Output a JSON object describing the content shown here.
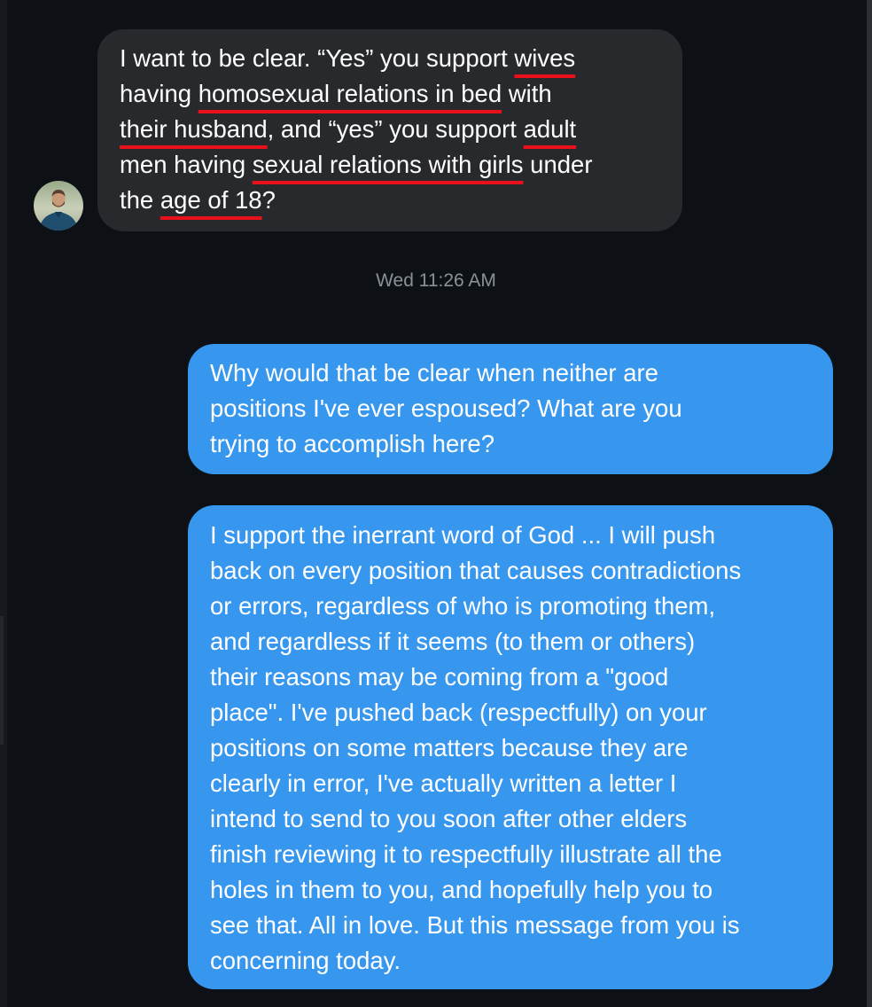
{
  "conversation": {
    "incoming_message": {
      "lines": [
        [
          {
            "text": "I want to be clear. “Yes” you support ",
            "underlined": false
          },
          {
            "text": "wives",
            "underlined": true
          }
        ],
        [
          {
            "text": "having ",
            "underlined": false
          },
          {
            "text": "homosexual relations in bed",
            "underlined": true
          },
          {
            "text": " with",
            "underlined": false
          }
        ],
        [
          {
            "text": "their husband",
            "underlined": true
          },
          {
            "text": ", and “yes” you support ",
            "underlined": false
          },
          {
            "text": "adult",
            "underlined": true
          }
        ],
        [
          {
            "text": "men having ",
            "underlined": false
          },
          {
            "text": "sexual relations with girls",
            "underlined": true
          },
          {
            "text": " under",
            "underlined": false
          }
        ],
        [
          {
            "text": "the ",
            "underlined": false
          },
          {
            "text": "age of 18",
            "underlined": true
          },
          {
            "text": "?",
            "underlined": false
          }
        ]
      ]
    },
    "timestamp": "Wed 11:26 AM",
    "outgoing_messages": [
      {
        "text": "Why would that be clear when neither are\npositions I've ever espoused? What are you\ntrying to accomplish here?"
      },
      {
        "text": "I support the inerrant word of God ... I will push\nback on every position that causes contradictions\nor errors, regardless of who is promoting them,\nand regardless if it seems (to them or others)\ntheir reasons may be coming from a \"good\nplace\". I've pushed back (respectfully) on your\npositions on some matters because they are\nclearly in error, I've actually written a letter I\nintend to send to you soon after other elders\nfinish reviewing it to respectfully illustrate all the\nholes in them to you, and hopefully help you to\nsee that. All in love. But this message from you is\nconcerning today."
      }
    ]
  },
  "colors": {
    "background": "#0d1116",
    "incoming_bubble": "#27292c",
    "outgoing_bubble": "#3797ee",
    "underline_annotation": "#e8101a",
    "timestamp_text": "#8b9096"
  }
}
